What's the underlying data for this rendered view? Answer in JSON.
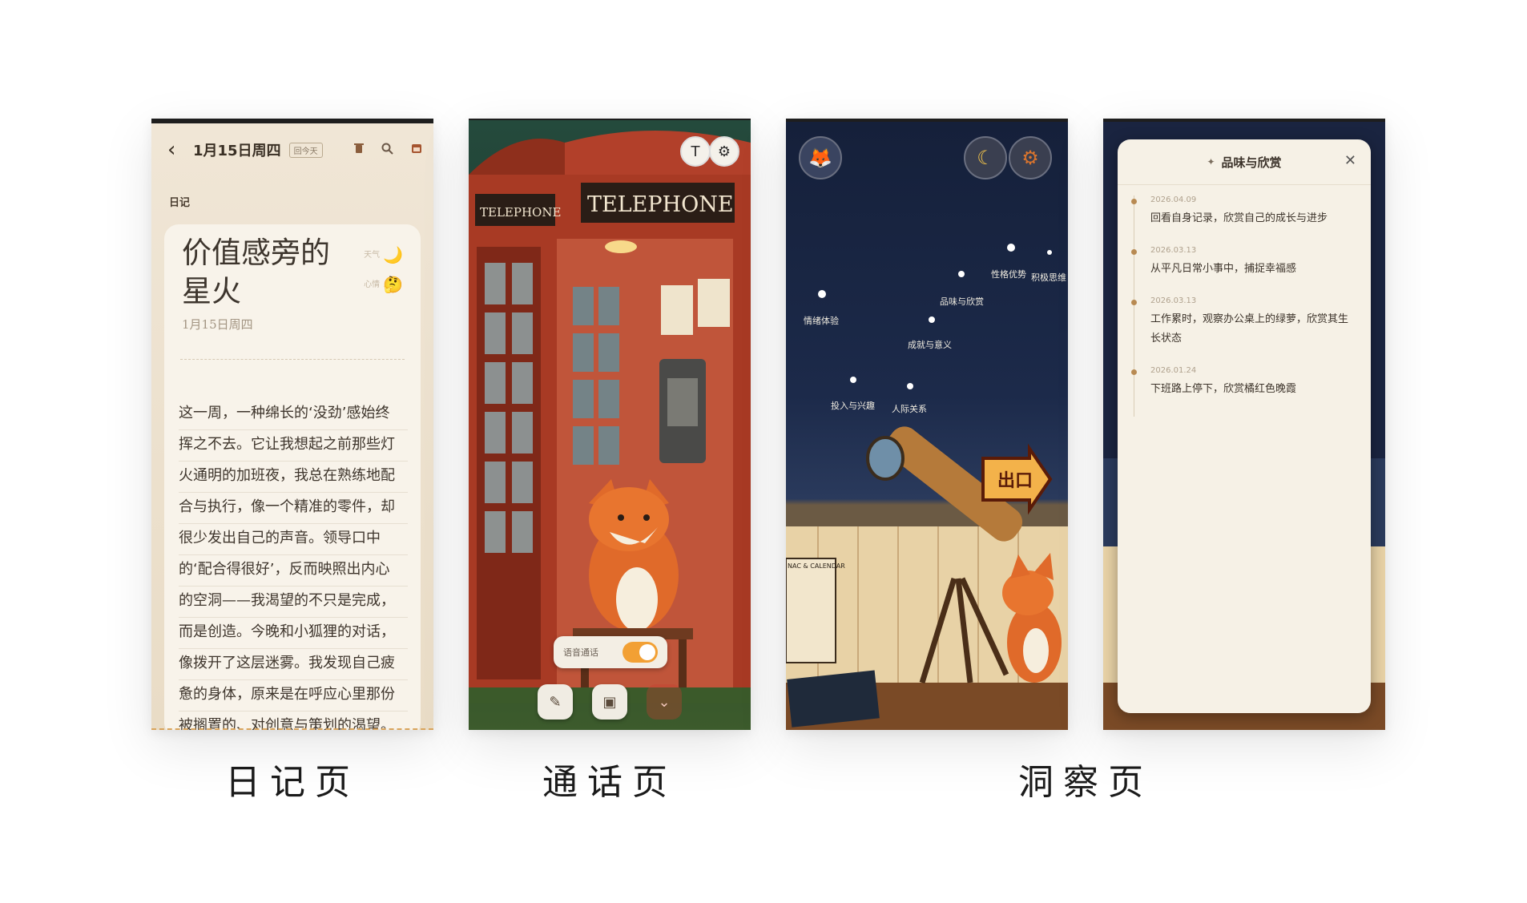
{
  "captions": {
    "diary": "日记页",
    "call": "通话页",
    "insight": "洞察页"
  },
  "diary": {
    "header": {
      "back_icon": "‹",
      "date": "1月15日周四",
      "today_chip": "回今天",
      "icons": [
        "trash-icon",
        "search-icon",
        "calendar-icon"
      ]
    },
    "section": "日记",
    "entry": {
      "title": "价值感旁的星火",
      "weather_label": "天气",
      "weather_emoji": "🌙",
      "mood_label": "心情",
      "mood_emoji": "🤔",
      "subdate": "1月15日周四",
      "lines": [
        "这一周，一种绵长的‘没劲’感始终",
        "挥之不去。它让我想起之前那些灯",
        "火通明的加班夜，我总在熟练地配",
        "合与执行，像一个精准的零件，却",
        "很少发出自己的声音。领导口中",
        "的‘配合得很好’，反而映照出内心",
        "的空洞——我渴望的不只是完成，",
        "而是创造。今晚和小狐狸的对话，",
        "像拨开了这层迷雾。我发现自己疲",
        "惫的身体，原来是在呼应心里那份",
        "被搁置的、对创意与策划的渴望。"
      ]
    }
  },
  "call": {
    "top_buttons": [
      "T",
      "⚙"
    ],
    "booth_sign_front": "TELEPHONE",
    "booth_sign_side": "TELEPHONE",
    "voice_toggle_label": "语音通话",
    "voice_toggle_on": true,
    "bottom_buttons": [
      "✎",
      "▣",
      "⌄"
    ]
  },
  "insight": {
    "stars": [
      {
        "label": "情绪体验"
      },
      {
        "label": "品味与欣赏"
      },
      {
        "label": "性格优势"
      },
      {
        "label": "积极思维"
      },
      {
        "label": "成就与意义"
      },
      {
        "label": "投入与兴趣"
      },
      {
        "label": "人际关系"
      }
    ],
    "exit_sign": "出口",
    "calendar_sign": "NAC & CALENDAR"
  },
  "insight_detail": {
    "title": "品味与欣赏",
    "entries": [
      {
        "date": "2026.04.09",
        "text": "回看自身记录，欣赏自己的成长与进步"
      },
      {
        "date": "2026.03.13",
        "text": "从平凡日常小事中，捕捉幸福感"
      },
      {
        "date": "2026.03.13",
        "text": "工作累时，观察办公桌上的绿萝，欣赏其生长状态"
      },
      {
        "date": "2026.01.24",
        "text": "下班路上停下，欣赏橘红色晚霞"
      }
    ]
  }
}
